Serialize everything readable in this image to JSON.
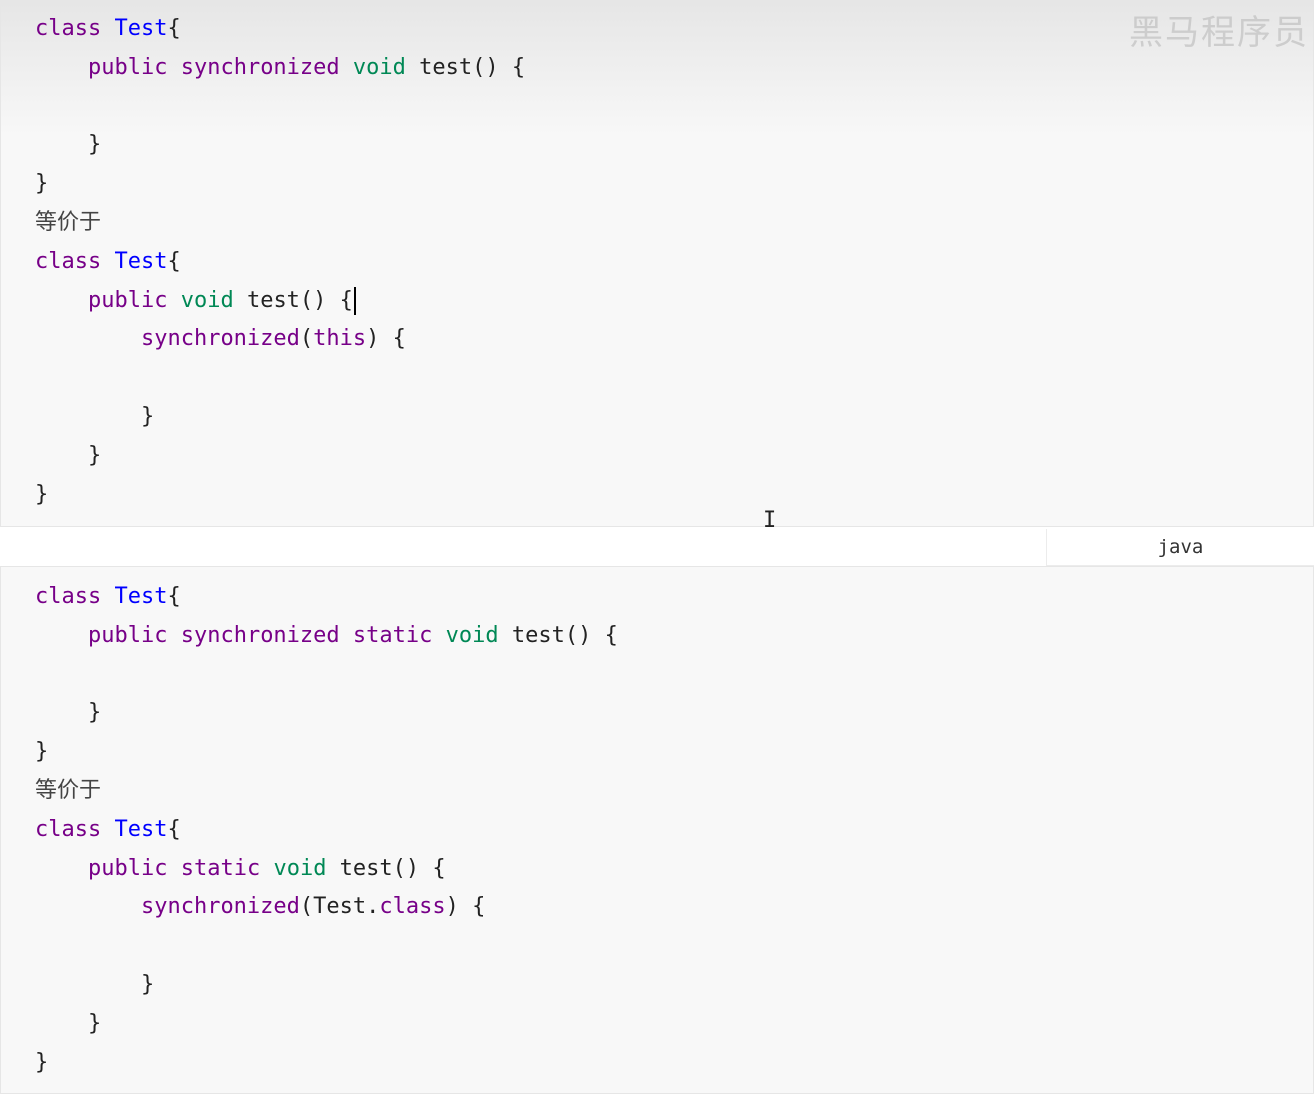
{
  "watermark": "黑马程序员",
  "language_label": "java",
  "blocks": [
    {
      "lines": [
        [
          {
            "t": "keyword",
            "v": "class"
          },
          {
            "t": "plain",
            "v": " "
          },
          {
            "t": "def",
            "v": "Test"
          },
          {
            "t": "plain",
            "v": "{"
          }
        ],
        [
          {
            "t": "plain",
            "v": "    "
          },
          {
            "t": "keyword",
            "v": "public"
          },
          {
            "t": "plain",
            "v": " "
          },
          {
            "t": "keyword",
            "v": "synchronized"
          },
          {
            "t": "plain",
            "v": " "
          },
          {
            "t": "type",
            "v": "void"
          },
          {
            "t": "plain",
            "v": " test() {"
          }
        ],
        [],
        [
          {
            "t": "plain",
            "v": "    }"
          }
        ],
        [
          {
            "t": "plain",
            "v": "}"
          }
        ],
        [
          {
            "t": "cn",
            "v": "等价于"
          }
        ],
        [
          {
            "t": "keyword",
            "v": "class"
          },
          {
            "t": "plain",
            "v": " "
          },
          {
            "t": "def",
            "v": "Test"
          },
          {
            "t": "plain",
            "v": "{"
          }
        ],
        [
          {
            "t": "plain",
            "v": "    "
          },
          {
            "t": "keyword",
            "v": "public"
          },
          {
            "t": "plain",
            "v": " "
          },
          {
            "t": "type",
            "v": "void"
          },
          {
            "t": "plain",
            "v": " test() {"
          },
          {
            "t": "caret",
            "v": ""
          }
        ],
        [
          {
            "t": "plain",
            "v": "        "
          },
          {
            "t": "keyword",
            "v": "synchronized"
          },
          {
            "t": "plain",
            "v": "("
          },
          {
            "t": "keyword",
            "v": "this"
          },
          {
            "t": "plain",
            "v": ") {"
          }
        ],
        [],
        [
          {
            "t": "plain",
            "v": "        }"
          }
        ],
        [
          {
            "t": "plain",
            "v": "    }"
          }
        ],
        [
          {
            "t": "plain",
            "v": "}"
          }
        ]
      ]
    },
    {
      "lines": [
        [
          {
            "t": "keyword",
            "v": "class"
          },
          {
            "t": "plain",
            "v": " "
          },
          {
            "t": "def",
            "v": "Test"
          },
          {
            "t": "plain",
            "v": "{"
          }
        ],
        [
          {
            "t": "plain",
            "v": "    "
          },
          {
            "t": "keyword",
            "v": "public"
          },
          {
            "t": "plain",
            "v": " "
          },
          {
            "t": "keyword",
            "v": "synchronized"
          },
          {
            "t": "plain",
            "v": " "
          },
          {
            "t": "keyword",
            "v": "static"
          },
          {
            "t": "plain",
            "v": " "
          },
          {
            "t": "type",
            "v": "void"
          },
          {
            "t": "plain",
            "v": " test() {"
          }
        ],
        [],
        [
          {
            "t": "plain",
            "v": "    }"
          }
        ],
        [
          {
            "t": "plain",
            "v": "}"
          }
        ],
        [
          {
            "t": "cn",
            "v": "等价于"
          }
        ],
        [
          {
            "t": "keyword",
            "v": "class"
          },
          {
            "t": "plain",
            "v": " "
          },
          {
            "t": "def",
            "v": "Test"
          },
          {
            "t": "plain",
            "v": "{"
          }
        ],
        [
          {
            "t": "plain",
            "v": "    "
          },
          {
            "t": "keyword",
            "v": "public"
          },
          {
            "t": "plain",
            "v": " "
          },
          {
            "t": "keyword",
            "v": "static"
          },
          {
            "t": "plain",
            "v": " "
          },
          {
            "t": "type",
            "v": "void"
          },
          {
            "t": "plain",
            "v": " test() {"
          }
        ],
        [
          {
            "t": "plain",
            "v": "        "
          },
          {
            "t": "keyword",
            "v": "synchronized"
          },
          {
            "t": "plain",
            "v": "(Test."
          },
          {
            "t": "keyword",
            "v": "class"
          },
          {
            "t": "plain",
            "v": ") {"
          }
        ],
        [],
        [
          {
            "t": "plain",
            "v": "        }"
          }
        ],
        [
          {
            "t": "plain",
            "v": "    }"
          }
        ],
        [
          {
            "t": "plain",
            "v": "}"
          }
        ]
      ]
    }
  ]
}
